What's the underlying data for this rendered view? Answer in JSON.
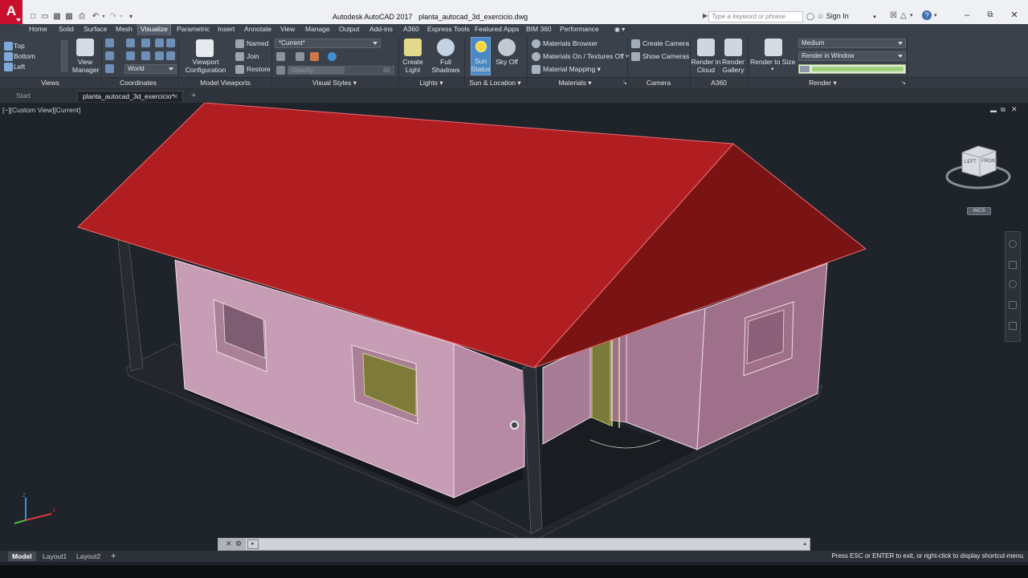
{
  "app": {
    "logo_letter": "A",
    "title": "Autodesk AutoCAD 2017",
    "filename": "planta_autocad_3d_exercicio.dwg",
    "search_placeholder": "Type a keyword or phrase",
    "signin_label": "Sign In"
  },
  "ribbon_tabs": [
    "Home",
    "Solid",
    "Surface",
    "Mesh",
    "Visualize",
    "Parametric",
    "Insert",
    "Annotate",
    "View",
    "Manage",
    "Output",
    "Add-ins",
    "A360",
    "Express Tools",
    "Featured Apps",
    "BIM 360",
    "Performance"
  ],
  "active_tab": "Visualize",
  "panels": {
    "views": {
      "title": "Views",
      "items": [
        "Top",
        "Bottom",
        "Left"
      ],
      "view_manager_label_1": "View",
      "view_manager_label_2": "Manager"
    },
    "coordinates": {
      "title": "Coordinates",
      "ucs_value": "World"
    },
    "model_viewports": {
      "title": "Model Viewports",
      "config_label_1": "Viewport",
      "config_label_2": "Configuration",
      "named": "Named",
      "join": "Join",
      "restore": "Restore"
    },
    "visual_styles": {
      "title": "Visual Styles",
      "current": "*Current*",
      "opacity_label": "Opacity",
      "opacity_value": "60"
    },
    "lights": {
      "title": "Lights",
      "create_light_1": "Create",
      "create_light_2": "Light",
      "full_shadows_1": "Full",
      "full_shadows_2": "Shadows"
    },
    "sun_location": {
      "title": "Sun & Location",
      "sun_status_1": "Sun",
      "sun_status_2": "Status",
      "sky_off": "Sky Off"
    },
    "materials": {
      "title": "Materials",
      "browser": "Materials Browser",
      "on_textures": "Materials On / Textures Off",
      "mapping": "Material Mapping"
    },
    "camera": {
      "title": "Camera",
      "create": "Create Camera",
      "show": "Show  Cameras"
    },
    "a360": {
      "title": "A360",
      "render_cloud_1": "Render in",
      "render_cloud_2": "Cloud",
      "render_gallery_1": "Render",
      "render_gallery_2": "Gallery"
    },
    "render": {
      "title": "Render",
      "render_size_1": "Render to Size",
      "quality": "Medium",
      "target": "Render in Window"
    }
  },
  "file_tabs": [
    "Start",
    "planta_autocad_3d_exercicio*"
  ],
  "viewport_label": "[−][Custom View][Current]",
  "viewcube": {
    "left": "LEFT",
    "front": "FRONT",
    "wcs": "WCS"
  },
  "layout_tabs": [
    "Model",
    "Layout1",
    "Layout2"
  ],
  "status_message": "Press ESC or ENTER to exit, or right-click to display shortcut-menu.",
  "colors": {
    "roof": "#b01e22",
    "walls": "#c9a0b6",
    "accent_blue": "#3d8fd8",
    "autocad_red": "#c8102e"
  }
}
